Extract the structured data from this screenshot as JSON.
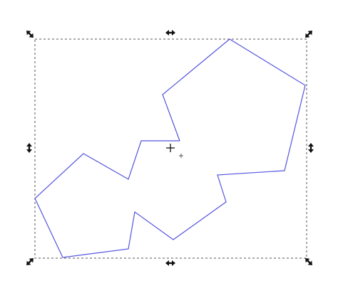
{
  "canvas": {
    "background": "#ffffff",
    "stroke_color": "#5555dd",
    "selection_color": "#555555",
    "handle_color": "#111111"
  },
  "selection": {
    "tool": "select",
    "handles": {
      "scale_corners": [
        "top-left",
        "top-right",
        "bottom-left",
        "bottom-right"
      ],
      "scale_edges": [
        "top",
        "bottom",
        "left",
        "right"
      ],
      "icons": {
        "corner": "diagonal-resize-arrow-icon",
        "edge_horizontal": "horizontal-resize-arrow-icon",
        "edge_vertical": "vertical-resize-arrow-icon"
      }
    },
    "rotation_center_icon": "crosshair-plus-icon",
    "object_center_icon": "small-plus-icon"
  },
  "object": {
    "type": "path",
    "shape": "open-polygon"
  }
}
